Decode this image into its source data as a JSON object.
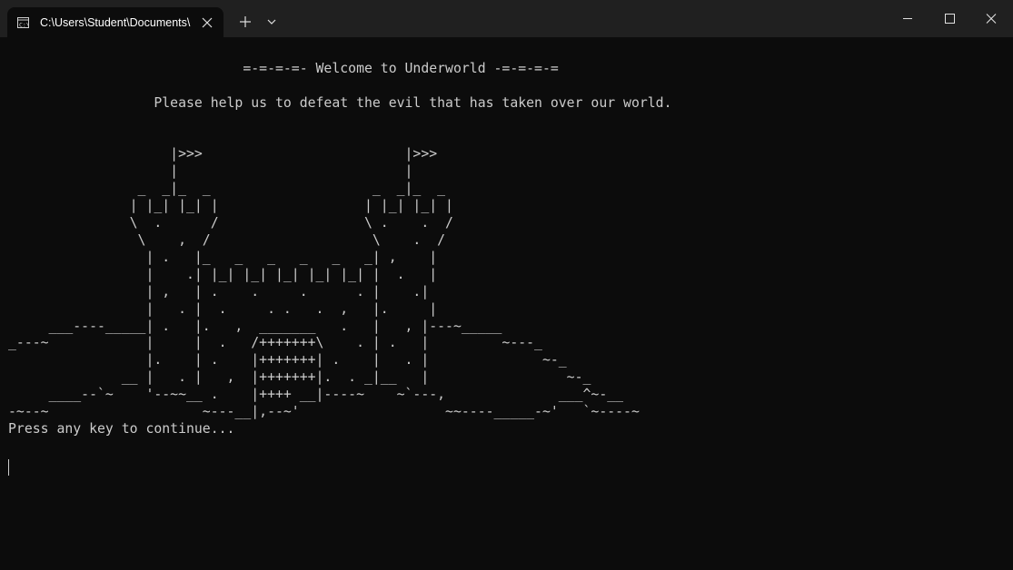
{
  "tab": {
    "title": "C:\\Users\\Student\\Documents\\",
    "icon": "terminal-icon"
  },
  "toolbar": {
    "new_tab_icon": "plus-icon",
    "dropdown_icon": "chevron-down-icon"
  },
  "window_controls": {
    "minimize_icon": "minimize-icon",
    "maximize_icon": "maximize-icon",
    "close_icon": "close-icon"
  },
  "colors": {
    "background": "#0c0c0c",
    "titlebar": "#202020",
    "text": "#cccccc"
  },
  "console": {
    "output": "\n                             =-=-=-=- Welcome to Underworld -=-=-=-=\n\n                  Please help us to defeat the evil that has taken over our world.\n\n\n                    |>>>                         |>>>\n                    |                            |\n                _  _|_  _                    _  _|_  _\n               | |_| |_| |                  | |_| |_| |\n               \\  .      /                  \\ .    .  /\n                \\    ,  /                    \\    .  /\n                 | .   |_   _   _   _   _   _| ,    |\n                 |    .| |_| |_| |_| |_| |_| |  .   |\n                 | ,   | .    .     .      . |    .|\n                 |   . |  .     . .   .  ,   |.     |\n     ___----_____| .   |.   ,  _______   .   |   , |---~_____\n_---~            |     |  .   /+++++++\\    . | .   |         ~---_\n                 |.    | .    |+++++++| .    |   . |              ~-_\n              __ |   . |   ,  |+++++++|.  . _|__   |                 ~-_\n     ____--`~    '--~~__ .    |++++ __|----~    ~`---,              ___^~-__\n-~--~                   ~---__|,--~'                  ~~----_____-~'   `~----~\nPress any key to continue..."
  }
}
